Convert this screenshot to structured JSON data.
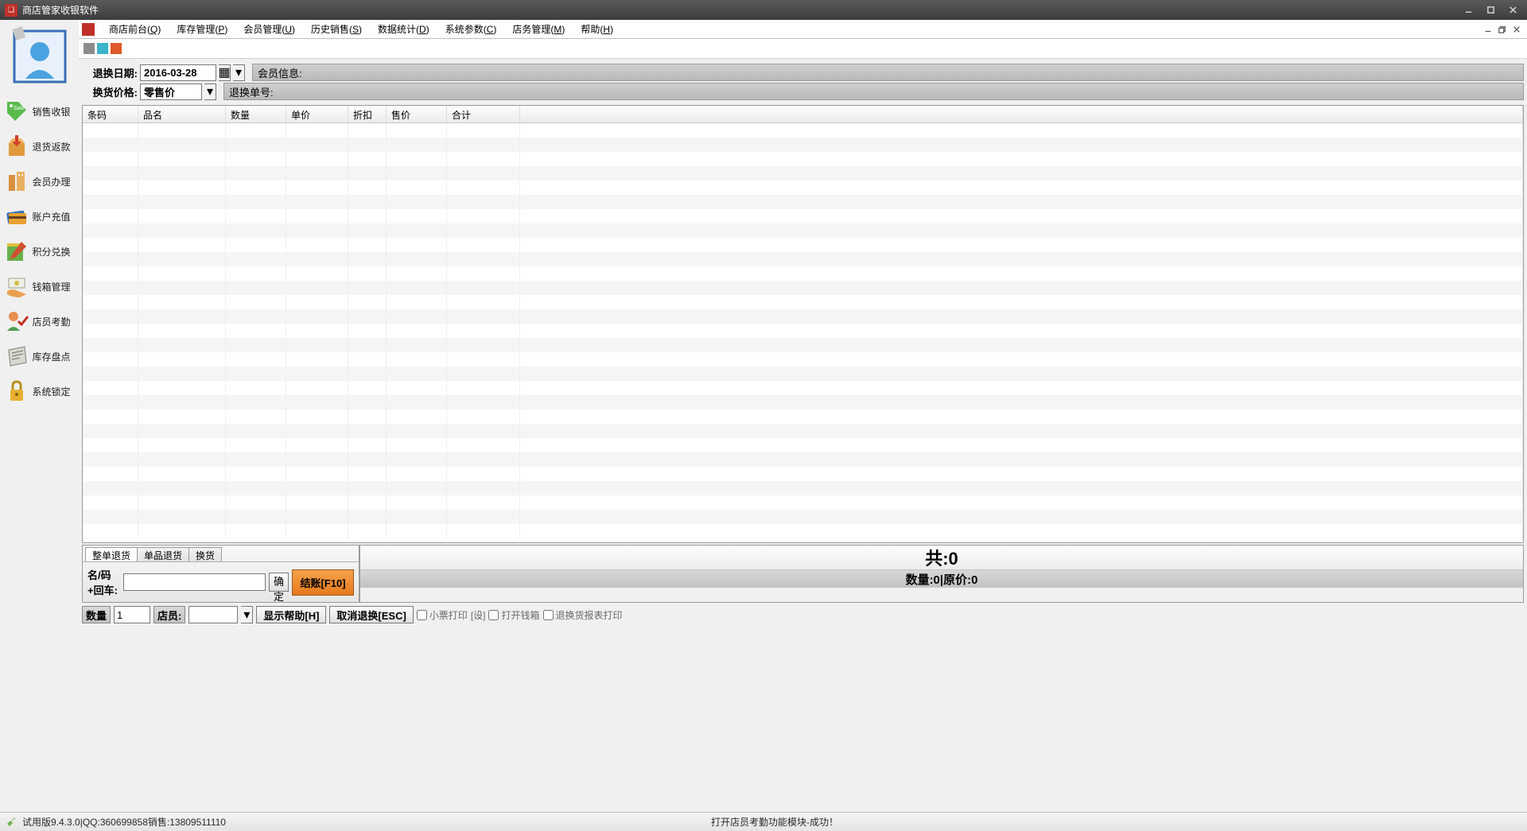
{
  "title": "商店管家收银软件",
  "menubar": [
    {
      "label": "商店前台",
      "key": "Q"
    },
    {
      "label": "库存管理",
      "key": "P"
    },
    {
      "label": "会员管理",
      "key": "U"
    },
    {
      "label": "历史销售",
      "key": "S"
    },
    {
      "label": "数据统计",
      "key": "D"
    },
    {
      "label": "系统参数",
      "key": "C"
    },
    {
      "label": "店务管理",
      "key": "M"
    },
    {
      "label": "帮助",
      "key": "H"
    }
  ],
  "sidebar": [
    {
      "label": "销售收银"
    },
    {
      "label": "退货返款"
    },
    {
      "label": "会员办理"
    },
    {
      "label": "账户充值"
    },
    {
      "label": "积分兑换"
    },
    {
      "label": "钱箱管理"
    },
    {
      "label": "店员考勤"
    },
    {
      "label": "库存盘点"
    },
    {
      "label": "系统锁定"
    }
  ],
  "form": {
    "return_date_label": "退换日期:",
    "return_date_value": "2016-03-28",
    "exchange_price_label": "换货价格:",
    "exchange_price_value": "零售价",
    "member_info_label": "会员信息:",
    "return_order_label": "退换单号:"
  },
  "grid": {
    "headers": [
      "条码",
      "品名",
      "数量",
      "单价",
      "折扣",
      "售价",
      "合计",
      ""
    ]
  },
  "tabs": [
    "整单退货",
    "单品退货",
    "换货"
  ],
  "tab_form": {
    "name_label": "名/码+回车:",
    "confirm_btn": "确定",
    "checkout_btn": "结账[F10]"
  },
  "summary": {
    "top": "共:0",
    "bottom": "数量:0|原价:0"
  },
  "action_bar": {
    "qty_label": "数量",
    "qty_value": "1",
    "clerk_label": "店员:",
    "help_btn": "显示帮助[H]",
    "cancel_btn": "取消退换[ESC]",
    "chk_receipt": "小票打印",
    "set_link": "[设]",
    "chk_drawer": "打开钱箱",
    "chk_report": "退换货报表打印"
  },
  "status": {
    "left": "试用版9.4.3.0|QQ:360699858销售:13809511110",
    "right": "打开店员考勤功能模块-成功！"
  }
}
